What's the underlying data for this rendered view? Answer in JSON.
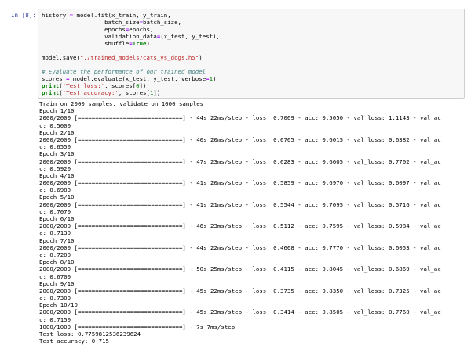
{
  "cell": {
    "prompt": "In [8]:",
    "code_lines": [
      [
        {
          "t": "history "
        },
        {
          "t": "=",
          "c": "eq"
        },
        {
          "t": " model.fit(x_train, y_train,"
        }
      ],
      [
        {
          "t": "                  batch_size"
        },
        {
          "t": "=",
          "c": "eq"
        },
        {
          "t": "batch_size,"
        }
      ],
      [
        {
          "t": "                  epochs"
        },
        {
          "t": "=",
          "c": "eq"
        },
        {
          "t": "epochs,"
        }
      ],
      [
        {
          "t": "                  validation_data"
        },
        {
          "t": "=",
          "c": "eq"
        },
        {
          "t": "(x_test, y_test),"
        }
      ],
      [
        {
          "t": "                  shuffle"
        },
        {
          "t": "=",
          "c": "eq"
        },
        {
          "t": "True",
          "c": "kw"
        },
        {
          "t": ")"
        }
      ],
      [
        {
          "t": ""
        }
      ],
      [
        {
          "t": "model.save("
        },
        {
          "t": "\"./trained_models/cats_vs_dogs.h5\"",
          "c": "str"
        },
        {
          "t": ")"
        }
      ],
      [
        {
          "t": ""
        }
      ],
      [
        {
          "t": "# Evaluate the performance of our trained model",
          "c": "cmt"
        }
      ],
      [
        {
          "t": "scores "
        },
        {
          "t": "=",
          "c": "eq"
        },
        {
          "t": " model.evaluate(x_test, y_test, verbose"
        },
        {
          "t": "=",
          "c": "eq"
        },
        {
          "t": "1",
          "c": "num"
        },
        {
          "t": ")"
        }
      ],
      [
        {
          "t": "print",
          "c": "kw"
        },
        {
          "t": "("
        },
        {
          "t": "'Test loss:'",
          "c": "str"
        },
        {
          "t": ", scores["
        },
        {
          "t": "0",
          "c": "num"
        },
        {
          "t": "])"
        }
      ],
      [
        {
          "t": "print",
          "c": "kw"
        },
        {
          "t": "("
        },
        {
          "t": "'Test accuracy:'",
          "c": "str"
        },
        {
          "t": ", scores["
        },
        {
          "t": "1",
          "c": "num"
        },
        {
          "t": "])"
        }
      ]
    ]
  },
  "output": {
    "lines": [
      "Train on 2000 samples, validate on 1000 samples",
      "Epoch 1/10",
      "2000/2000 [==============================] - 44s 22ms/step - loss: 0.7069 - acc: 0.5050 - val_loss: 1.1143 - val_ac",
      "c: 0.5000",
      "Epoch 2/10",
      "2000/2000 [==============================] - 40s 20ms/step - loss: 0.6765 - acc: 0.6015 - val_loss: 0.6382 - val_ac",
      "c: 0.6550",
      "Epoch 3/10",
      "2000/2000 [==============================] - 47s 23ms/step - loss: 0.6283 - acc: 0.6605 - val_loss: 0.7702 - val_ac",
      "c: 0.5920",
      "Epoch 4/10",
      "2000/2000 [==============================] - 41s 20ms/step - loss: 0.5859 - acc: 0.6970 - val_loss: 0.6097 - val_ac",
      "c: 0.6980",
      "Epoch 5/10",
      "2000/2000 [==============================] - 41s 21ms/step - loss: 0.5544 - acc: 0.7095 - val_loss: 0.5716 - val_ac",
      "c: 0.7070",
      "Epoch 6/10",
      "2000/2000 [==============================] - 46s 23ms/step - loss: 0.5112 - acc: 0.7595 - val_loss: 0.5984 - val_ac",
      "c: 0.7130",
      "Epoch 7/10",
      "2000/2000 [==============================] - 44s 22ms/step - loss: 0.4668 - acc: 0.7770 - val_loss: 0.6053 - val_ac",
      "c: 0.7200",
      "Epoch 8/10",
      "2000/2000 [==============================] - 50s 25ms/step - loss: 0.4115 - acc: 0.8045 - val_loss: 0.6869 - val_ac",
      "c: 0.6700",
      "Epoch 9/10",
      "2000/2000 [==============================] - 45s 22ms/step - loss: 0.3735 - acc: 0.8350 - val_loss: 0.7325 - val_ac",
      "c: 0.7300",
      "Epoch 10/10",
      "2000/2000 [==============================] - 45s 23ms/step - loss: 0.3414 - acc: 0.8505 - val_loss: 0.7760 - val_ac",
      "c: 0.7150",
      "1000/1000 [==============================] - 7s 7ms/step",
      "Test loss: 0.7759812536239624",
      "Test accuracy: 0.715"
    ]
  },
  "colors": {
    "prompt": "#303f9f",
    "keyword": "#008000",
    "string": "#ba2121",
    "comment": "#408080",
    "operator": "#aa22ff",
    "input_bg": "#f7f7f7"
  }
}
